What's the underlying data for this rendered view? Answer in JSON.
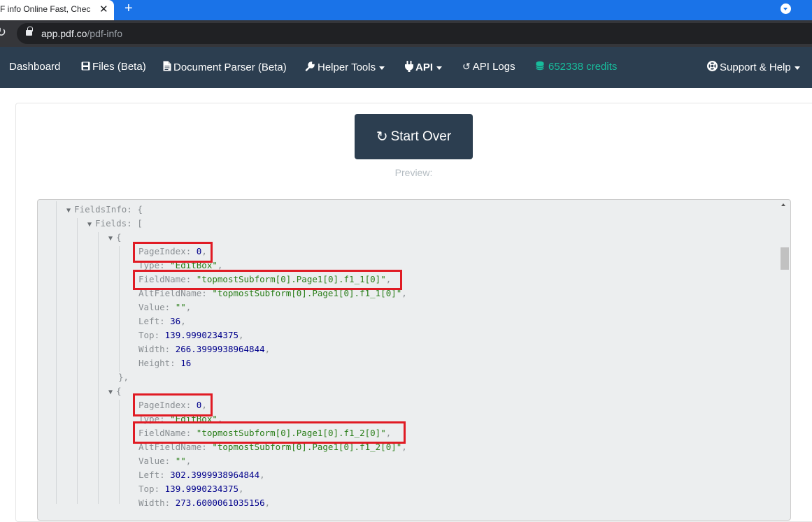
{
  "browser": {
    "tab_title": "F info Online Fast, Check N",
    "tab_close": "✕",
    "new_tab": "+",
    "url_host": "app.pdf.co",
    "url_path": "/pdf-info"
  },
  "nav": {
    "dashboard": "Dashboard",
    "files": "Files (Beta)",
    "document_parser": "Document Parser (Beta)",
    "helper_tools": "Helper Tools",
    "api": "API",
    "api_logs": "API Logs",
    "credits": "652338 credits",
    "support": "Support & Help"
  },
  "main": {
    "start_over": "Start Over",
    "preview_label": "Preview:"
  },
  "json_view": {
    "fields_info_key": "FieldsInfo: {",
    "fields_key": "Fields: [",
    "open_brace": "{",
    "close_brace": "},",
    "field1": {
      "page_index_key": "PageIndex: ",
      "page_index_val": "0",
      "type_key": "Type: ",
      "type_val": "\"EditBox\"",
      "field_name_key": "FieldName: ",
      "field_name_val": "\"topmostSubform[0].Page1[0].f1_1[0]\"",
      "alt_field_name_key": "AltFieldName: ",
      "alt_field_name_val": "\"topmostSubform[0].Page1[0].f1_1[0]\"",
      "value_key": "Value: ",
      "value_val": "\"\"",
      "left_key": "Left: ",
      "left_val": "36",
      "top_key": "Top: ",
      "top_val": "139.9990234375",
      "width_key": "Width: ",
      "width_val": "266.3999938964844",
      "height_key": "Height: ",
      "height_val": "16"
    },
    "field2": {
      "page_index_key": "PageIndex: ",
      "page_index_val": "0",
      "type_key": "Type: ",
      "type_val": "\"EditBox\"",
      "field_name_key": "FieldName: ",
      "field_name_val": "\"topmostSubform[0].Page1[0].f1_2[0]\"",
      "alt_field_name_key": "AltFieldName: ",
      "alt_field_name_val": "\"topmostSubform[0].Page1[0].f1_2[0]\"",
      "value_key": "Value: ",
      "value_val": "\"\"",
      "left_key": "Left: ",
      "left_val": "302.3999938964844",
      "top_key": "Top: ",
      "top_val": "139.9990234375",
      "width_key": "Width: ",
      "width_val": "273.6000061035156"
    }
  },
  "colors": {
    "tab_bar": "#1a73e8",
    "nav_bg": "#2c3e50",
    "credits": "#18bc9c",
    "highlight": "#e01b24",
    "number": "#00008b",
    "string": "#2a7e19"
  }
}
